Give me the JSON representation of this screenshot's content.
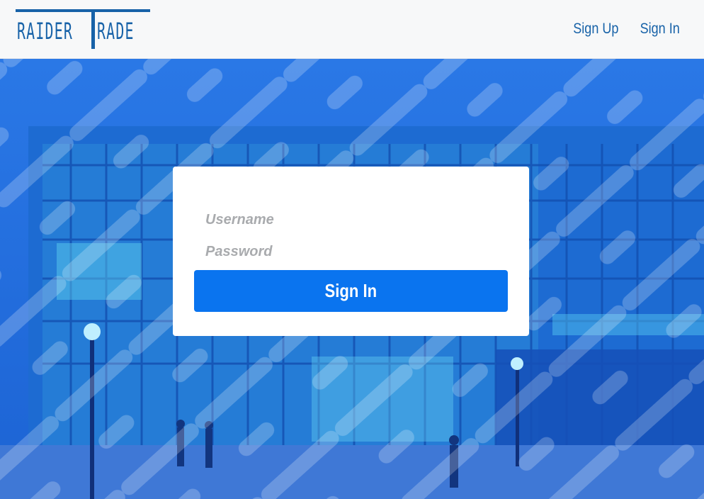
{
  "brand": {
    "logo_left": "RAIDER",
    "logo_right": "RADE",
    "logo_initial": "T"
  },
  "nav": {
    "sign_up": "Sign Up",
    "sign_in": "Sign In"
  },
  "login_form": {
    "username_placeholder": "Username",
    "password_placeholder": "Password",
    "submit_label": "Sign In"
  },
  "colors": {
    "brand": "#1762a8",
    "button": "#0a74ef",
    "hero_overlay": "#1769d6"
  }
}
